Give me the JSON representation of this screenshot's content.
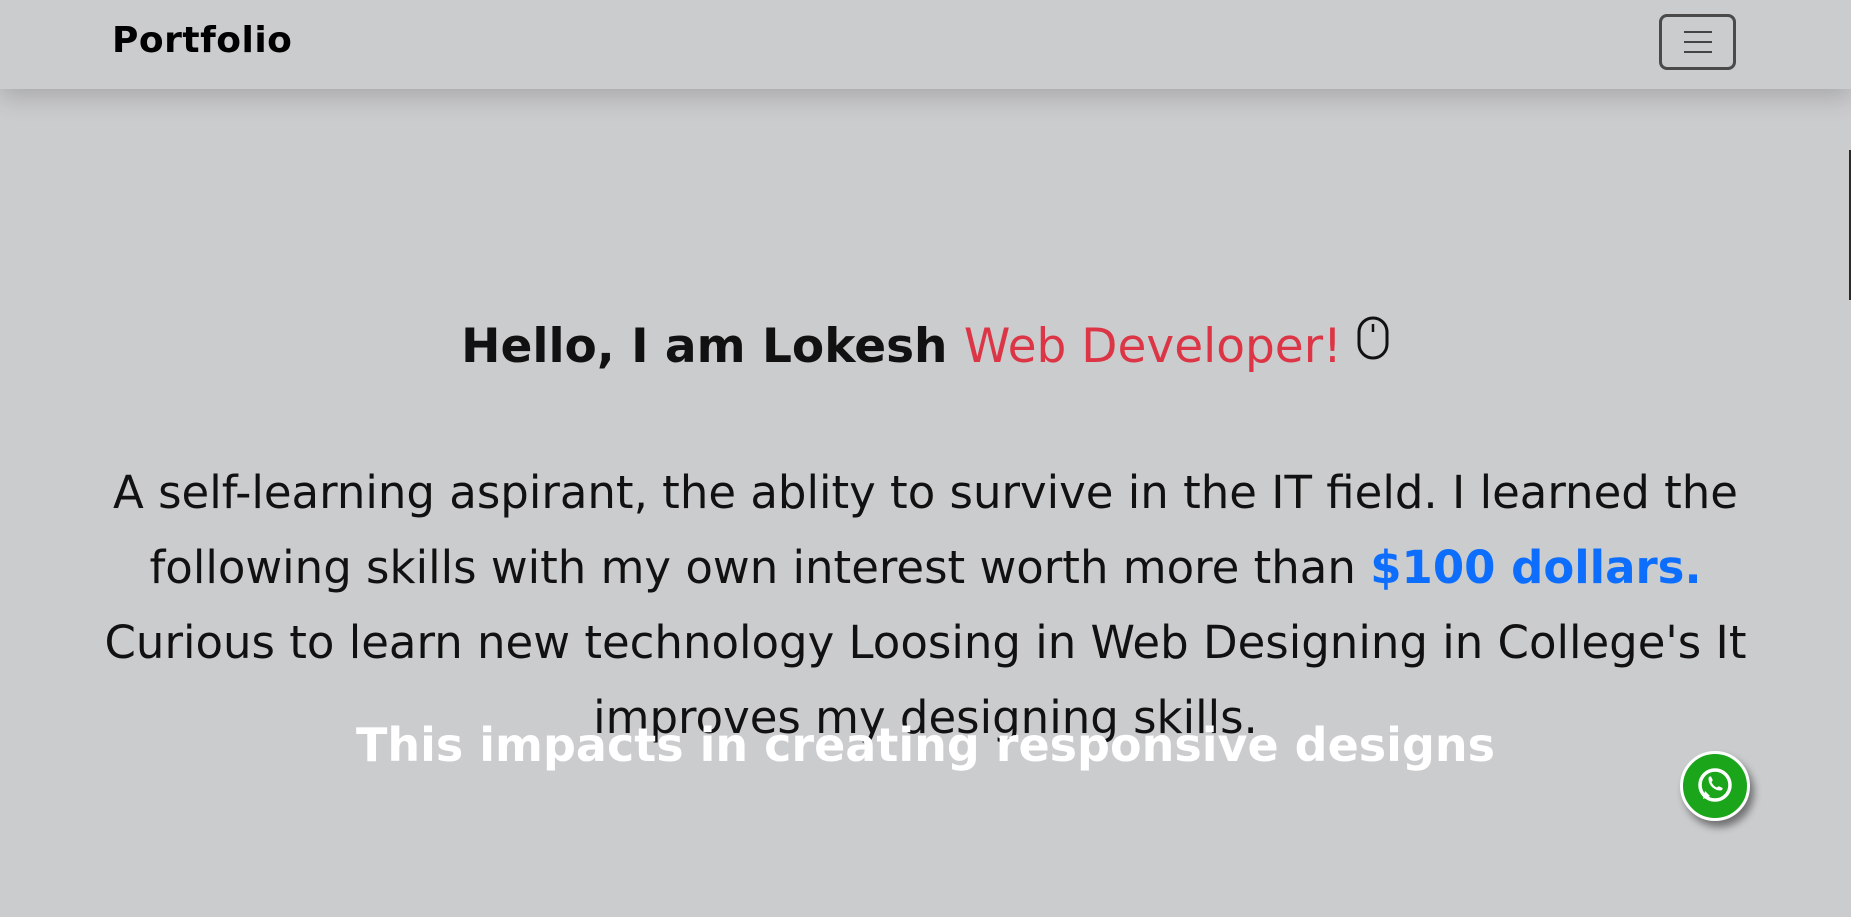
{
  "navbar": {
    "brand": "Portfolio",
    "menu_icon": "hamburger-menu-icon"
  },
  "hero": {
    "greeting": "Hello, I am Lokesh",
    "role": "Web Developer!",
    "role_color": "#dc3545",
    "scroll_icon": "mouse-icon",
    "description_part1": "A self-learning aspirant, the ablity to survive in the IT field. I learned the following skills with my own interest worth more than",
    "price": "$100 dollars.",
    "price_color": "#0d6efd",
    "description_part2": "Curious to learn new technology Loosing in Web Designing in College's It improves my designing skills.",
    "impact": "This impacts in creating responsive designs"
  },
  "floating": {
    "whatsapp_icon": "whatsapp-icon",
    "whatsapp_color": "#1aa51a"
  },
  "colors": {
    "background": "#cbccce",
    "text": "#111111"
  }
}
